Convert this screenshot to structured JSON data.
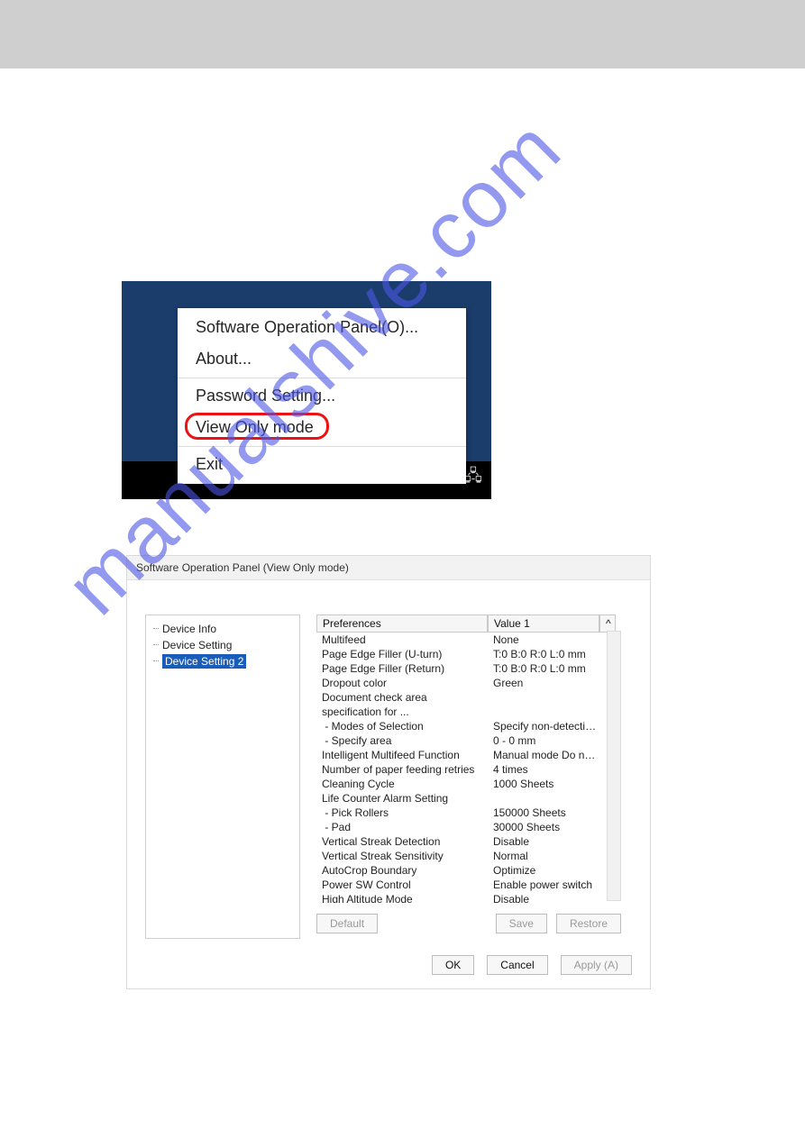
{
  "watermark_text": "manualshive.com",
  "context_menu": {
    "items": [
      "Software Operation Panel(O)...",
      "About...",
      "Password Setting...",
      "View Only mode",
      "Exit"
    ]
  },
  "dialog": {
    "title": "Software Operation Panel (View Only mode)",
    "tree": {
      "items": [
        "Device Info",
        "Device Setting",
        "Device Setting 2"
      ]
    },
    "table": {
      "header_pref": "Preferences",
      "header_val": "Value 1",
      "scroll_caret": "^",
      "rows": [
        {
          "pref": "Multifeed",
          "val": "None"
        },
        {
          "pref": "Page Edge Filler (U-turn)",
          "val": "T:0  B:0  R:0  L:0 mm"
        },
        {
          "pref": "Page Edge Filler (Return)",
          "val": "T:0  B:0  R:0  L:0 mm"
        },
        {
          "pref": "Dropout color",
          "val": "Green"
        },
        {
          "pref": "Document check area specification for ...",
          "val": ""
        },
        {
          "pref": " - Modes of Selection",
          "val": "Specify non-detection..."
        },
        {
          "pref": " - Specify area",
          "val": "0 - 0 mm"
        },
        {
          "pref": "Intelligent Multifeed Function",
          "val": "Manual mode  Do not..."
        },
        {
          "pref": "Number of paper feeding retries",
          "val": "4 times"
        },
        {
          "pref": "Cleaning Cycle",
          "val": "1000 Sheets"
        },
        {
          "pref": "Life Counter Alarm Setting",
          "val": ""
        },
        {
          "pref": " - Pick Rollers",
          "val": "150000 Sheets"
        },
        {
          "pref": " - Pad",
          "val": "30000 Sheets"
        },
        {
          "pref": "Vertical Streak Detection",
          "val": "Disable"
        },
        {
          "pref": "Vertical Streak Sensitivity",
          "val": "Normal"
        },
        {
          "pref": "AutoCrop Boundary",
          "val": "Optimize"
        },
        {
          "pref": "Power SW Control",
          "val": "Enable power switch"
        },
        {
          "pref": "High Altitude Mode",
          "val": "Disable"
        }
      ]
    },
    "buttons": {
      "default": "Default",
      "save": "Save",
      "restore": "Restore",
      "ok": "OK",
      "cancel": "Cancel",
      "apply": "Apply (A)"
    }
  }
}
